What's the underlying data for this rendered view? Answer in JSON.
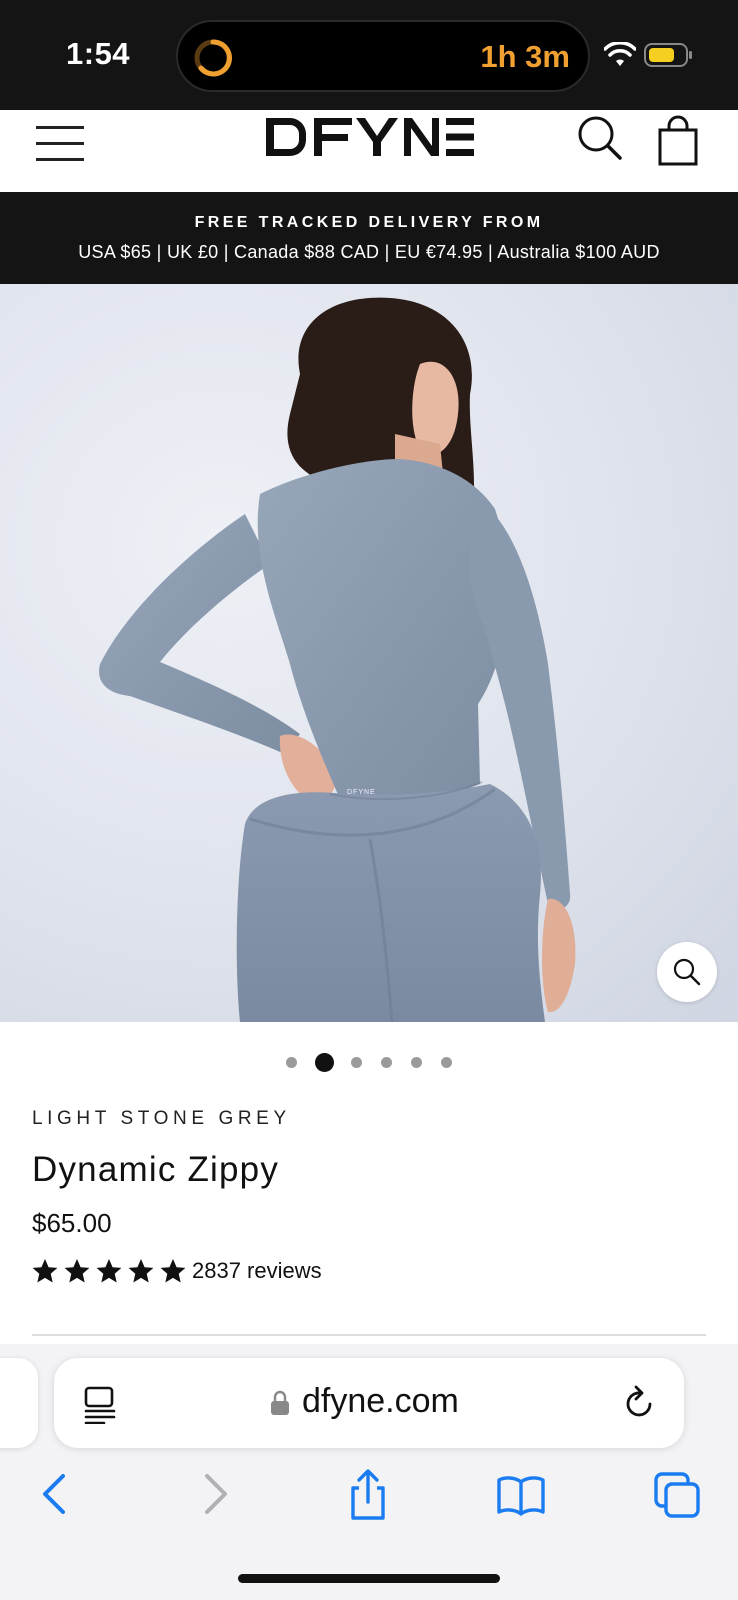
{
  "status_bar": {
    "time": "1:54",
    "live_activity_timer": "1h 3m",
    "icons": [
      "timer-ring-icon",
      "wifi-icon",
      "battery-icon"
    ],
    "accent_color": "#f0a030",
    "battery_color": "#f5d020"
  },
  "header": {
    "logo_text": "DFYNE",
    "icons": [
      "menu-icon",
      "search-icon",
      "shopping-bag-icon"
    ]
  },
  "banner": {
    "line1": "FREE TRACKED DELIVERY FROM",
    "line2": "USA $65 | UK £0 | Canada $88 CAD | EU €74.95 | Australia $100 AUD"
  },
  "gallery": {
    "image_description": "Model wearing light stone grey long-sleeve seamless top and leggings, viewed from behind",
    "image_count": 6,
    "active_index": 1,
    "zoom_icon": "magnifier-icon"
  },
  "product": {
    "variant": "LIGHT STONE GREY",
    "title": "Dynamic Zippy",
    "price": "$65.00",
    "rating_stars": 5,
    "review_count": "2837 reviews"
  },
  "browser": {
    "url": "dfyne.com",
    "icons": [
      "reader-icon",
      "lock-icon",
      "reload-icon",
      "back-icon",
      "forward-icon",
      "share-icon",
      "bookmarks-icon",
      "tabs-icon"
    ],
    "accent_color": "#1a7cf0"
  }
}
